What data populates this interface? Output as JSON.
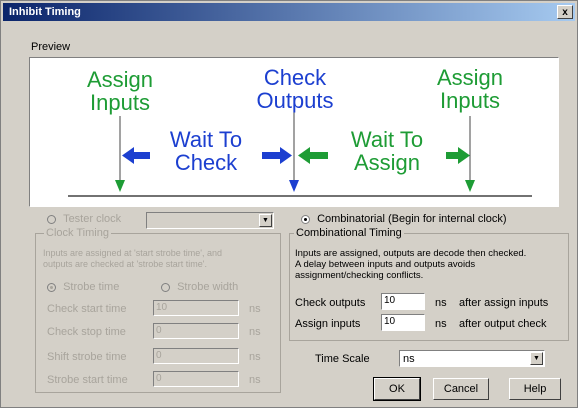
{
  "window": {
    "title": "Inhibit Timing",
    "close_label": "x"
  },
  "preview": {
    "label": "Preview",
    "assign_inputs_left": [
      "Assign",
      "Inputs"
    ],
    "check_outputs": [
      "Check",
      "Outputs"
    ],
    "assign_inputs_right": [
      "Assign",
      "Inputs"
    ],
    "wait_to_check": [
      "Wait To",
      "Check"
    ],
    "wait_to_assign": [
      "Wait To",
      "Assign"
    ]
  },
  "left_panel": {
    "radio_label": "Tester clock",
    "group_title": "Clock Timing",
    "description": [
      "Inputs are assigned at 'start strobe time', and",
      "outputs are checked at 'strobe start time'."
    ],
    "opt_strobe_time": "Strobe time",
    "opt_strobe_width": "Strobe width",
    "rows": [
      {
        "label": "Check start time",
        "value": "10",
        "unit": "ns"
      },
      {
        "label": "Check stop time",
        "value": "0",
        "unit": "ns"
      },
      {
        "label": "Shift strobe time",
        "value": "0",
        "unit": "ns"
      },
      {
        "label": "Strobe start time",
        "value": "0",
        "unit": "ns"
      }
    ]
  },
  "right_panel": {
    "radio_label": "Combinatorial (Begin for internal clock)",
    "group_title": "Combinational Timing",
    "description": [
      "Inputs are assigned, outputs are decode then checked.",
      "A delay between inputs and outputs avoids",
      "assignment/checking conflicts."
    ],
    "check_outputs_label": "Check outputs",
    "check_outputs_value": "10",
    "check_outputs_unit": "ns",
    "check_outputs_suffix": "after assign inputs",
    "assign_inputs_label": "Assign inputs",
    "assign_inputs_value": "10",
    "assign_inputs_unit": "ns",
    "assign_inputs_suffix": "after output check"
  },
  "time_scale": {
    "label": "Time Scale",
    "value": "ns"
  },
  "buttons": {
    "ok": "OK",
    "cancel": "Cancel",
    "help": "Help"
  },
  "colors": {
    "green": "#1e9c35",
    "blue": "#1c3fd0",
    "titlebar": "#0a246a"
  }
}
